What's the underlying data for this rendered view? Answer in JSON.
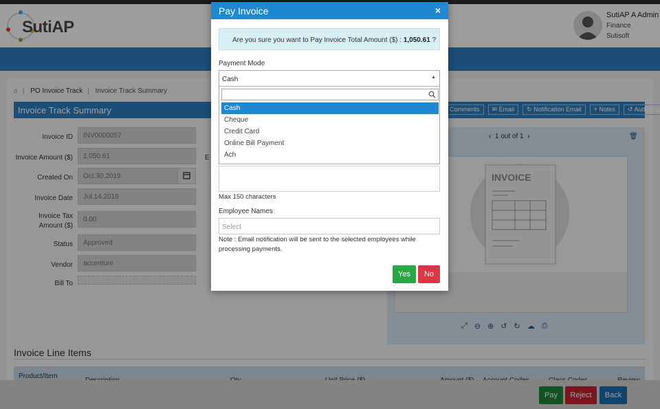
{
  "header": {
    "logo_text": "SutiAP",
    "user_name": "SutiAP A Admin",
    "user_role": "Finance",
    "user_org": "Sutisoft"
  },
  "breadcrumb": [
    "PO Invoice Track",
    "Invoice Track Summary"
  ],
  "page_title": "Invoice Track Summary",
  "toolbar": [
    "Comments",
    "Email",
    "Notification Email",
    "Notes",
    "Audit Log"
  ],
  "fields": {
    "invoice_id": {
      "label": "Invoice ID",
      "value": "INV0000057"
    },
    "invoice_amount": {
      "label": "Invoice Amount ($)",
      "value": "1,050.61"
    },
    "created_on": {
      "label": "Created On",
      "value": "Oct.30.2019"
    },
    "invoice_date": {
      "label": "Invoice Date",
      "value": "Jul.14.2019"
    },
    "tax": {
      "label1": "Invoice Tax",
      "label2": "Amount ($)",
      "value": "0.00"
    },
    "status": {
      "label": "Status",
      "value": "Approved"
    },
    "vendor": {
      "label": "Vendor",
      "value": "accenture"
    },
    "bill_to": {
      "label": "Bill To"
    },
    "partial_label": "E"
  },
  "viewer": {
    "pager": "1 out of 1",
    "doc_title": "INVOICE"
  },
  "line_items": {
    "title": "Invoice Line Items",
    "columns": [
      "Product/Item",
      "Description",
      "Qty",
      "Unit Price ($)",
      "Amount ($)",
      "Account Codes",
      "Class Codes",
      "Review"
    ]
  },
  "footer_buttons": {
    "pay": "Pay",
    "reject": "Reject",
    "back": "Back"
  },
  "modal": {
    "title": "Pay Invoice",
    "close": "×",
    "confirm_text": "Are you sure you want to Pay Invoice Total Amount ($) :",
    "confirm_amount": "1,050.61",
    "confirm_suffix": "?",
    "payment_mode_label": "Payment Mode",
    "payment_mode_value": "Cash",
    "options": [
      "Cash",
      "Cheque",
      "Credit Card",
      "Online Bill Payment",
      "Ach"
    ],
    "max_chars": "Max 150 characters",
    "employee_label": "Employee Names",
    "employee_placeholder": "Select",
    "note": "Note : Email notification will be sent to the selected employees while processing payments.",
    "yes": "Yes",
    "no": "No"
  },
  "colors": {
    "primary": "#1e88d0",
    "yes": "#28a745",
    "no": "#dc3545",
    "pay": "#218838",
    "reject": "#c82333",
    "back": "#1c6fb3"
  }
}
